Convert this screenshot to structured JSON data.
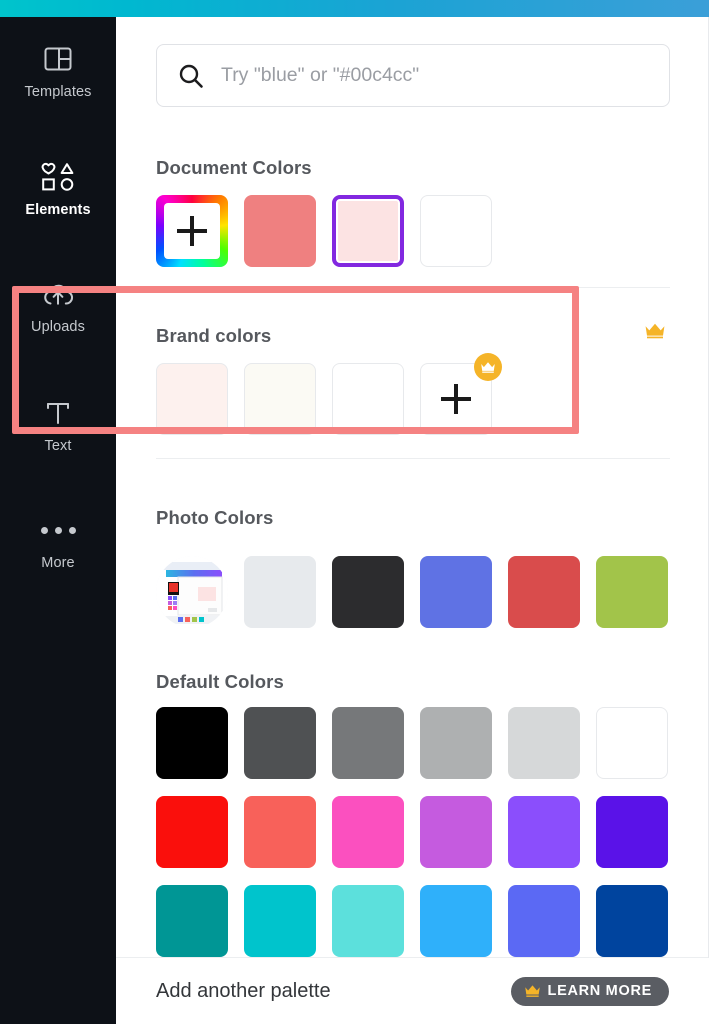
{
  "topbar": {
    "gradient_from": "#00c4cc",
    "gradient_to": "#3b9fd8"
  },
  "sidebar": {
    "background": "#0d1117",
    "items": [
      {
        "label": "Templates",
        "icon": "templates-icon",
        "active": false
      },
      {
        "label": "Elements",
        "icon": "elements-icon",
        "active": true
      },
      {
        "label": "Uploads",
        "icon": "uploads-cloud-icon",
        "active": false
      },
      {
        "label": "Text",
        "icon": "text-t-icon",
        "active": false
      },
      {
        "label": "More",
        "icon": "more-dots-icon",
        "active": false
      }
    ]
  },
  "search": {
    "placeholder": "Try \"blue\" or \"#00c4cc\"",
    "value": "",
    "icon": "search-icon"
  },
  "sections": {
    "document_colors": {
      "title": "Document Colors",
      "swatches": [
        {
          "name": "add-color",
          "type": "rainbow-add",
          "color": "#ffffff"
        },
        {
          "name": "salmon",
          "type": "solid",
          "color": "#ef8080"
        },
        {
          "name": "pale-pink",
          "type": "solid",
          "color": "#fce3e3",
          "selected": true
        },
        {
          "name": "white",
          "type": "solid",
          "color": "#ffffff",
          "bordered": true
        }
      ]
    },
    "brand_colors": {
      "title": "Brand colors",
      "crown_icon": "crown-icon",
      "highlighted": true,
      "highlight_color": "#f58282",
      "swatches": [
        {
          "name": "brand-pale-pink",
          "type": "solid",
          "color": "#fdf1ee",
          "bordered": true
        },
        {
          "name": "brand-cream",
          "type": "solid",
          "color": "#fbfaf4",
          "bordered": true
        },
        {
          "name": "brand-white",
          "type": "solid",
          "color": "#ffffff",
          "bordered": true
        },
        {
          "name": "add-brand-color",
          "type": "add-pro",
          "color": "#ffffff",
          "badge_icon": "crown-icon",
          "badge_color": "#f5b428"
        }
      ]
    },
    "photo_colors": {
      "title": "Photo Colors",
      "thumbnail": {
        "name": "photo-thumbnail",
        "alt": "design editor screenshot"
      },
      "swatches": [
        {
          "name": "light-gray",
          "type": "solid",
          "color": "#e7eaed"
        },
        {
          "name": "near-black",
          "type": "solid",
          "color": "#2c2c2e"
        },
        {
          "name": "periwinkle-blue",
          "type": "solid",
          "color": "#5f72e4"
        },
        {
          "name": "brick-red",
          "type": "solid",
          "color": "#d94c4c"
        },
        {
          "name": "olive-green",
          "type": "solid",
          "color": "#a2c44a"
        }
      ]
    },
    "default_colors": {
      "title": "Default Colors",
      "rows": [
        [
          {
            "name": "black",
            "color": "#000000"
          },
          {
            "name": "dark-gray",
            "color": "#4f5153"
          },
          {
            "name": "gray",
            "color": "#76787a"
          },
          {
            "name": "medium-gray",
            "color": "#aeb0b1"
          },
          {
            "name": "light-gray",
            "color": "#d6d8d9"
          },
          {
            "name": "white",
            "color": "#ffffff",
            "bordered": true
          }
        ],
        [
          {
            "name": "red",
            "color": "#fa0f0c"
          },
          {
            "name": "coral-red",
            "color": "#f8615a"
          },
          {
            "name": "pink",
            "color": "#fb50bf"
          },
          {
            "name": "orchid",
            "color": "#c55bdf"
          },
          {
            "name": "purple",
            "color": "#8b4efc"
          },
          {
            "name": "violet",
            "color": "#5a12e8"
          }
        ],
        [
          {
            "name": "teal-dark",
            "color": "#009695"
          },
          {
            "name": "cyan",
            "color": "#00c4cc"
          },
          {
            "name": "aqua",
            "color": "#5ce0dc"
          },
          {
            "name": "sky-blue",
            "color": "#2fb0fa"
          },
          {
            "name": "royal-blue",
            "color": "#5b69f4"
          },
          {
            "name": "navy",
            "color": "#00449e"
          }
        ]
      ]
    }
  },
  "footer": {
    "add_palette_label": "Add another palette",
    "learn_more_label": "LEARN MORE",
    "learn_more_icon": "crown-icon",
    "learn_more_bg": "#5a5d63"
  }
}
